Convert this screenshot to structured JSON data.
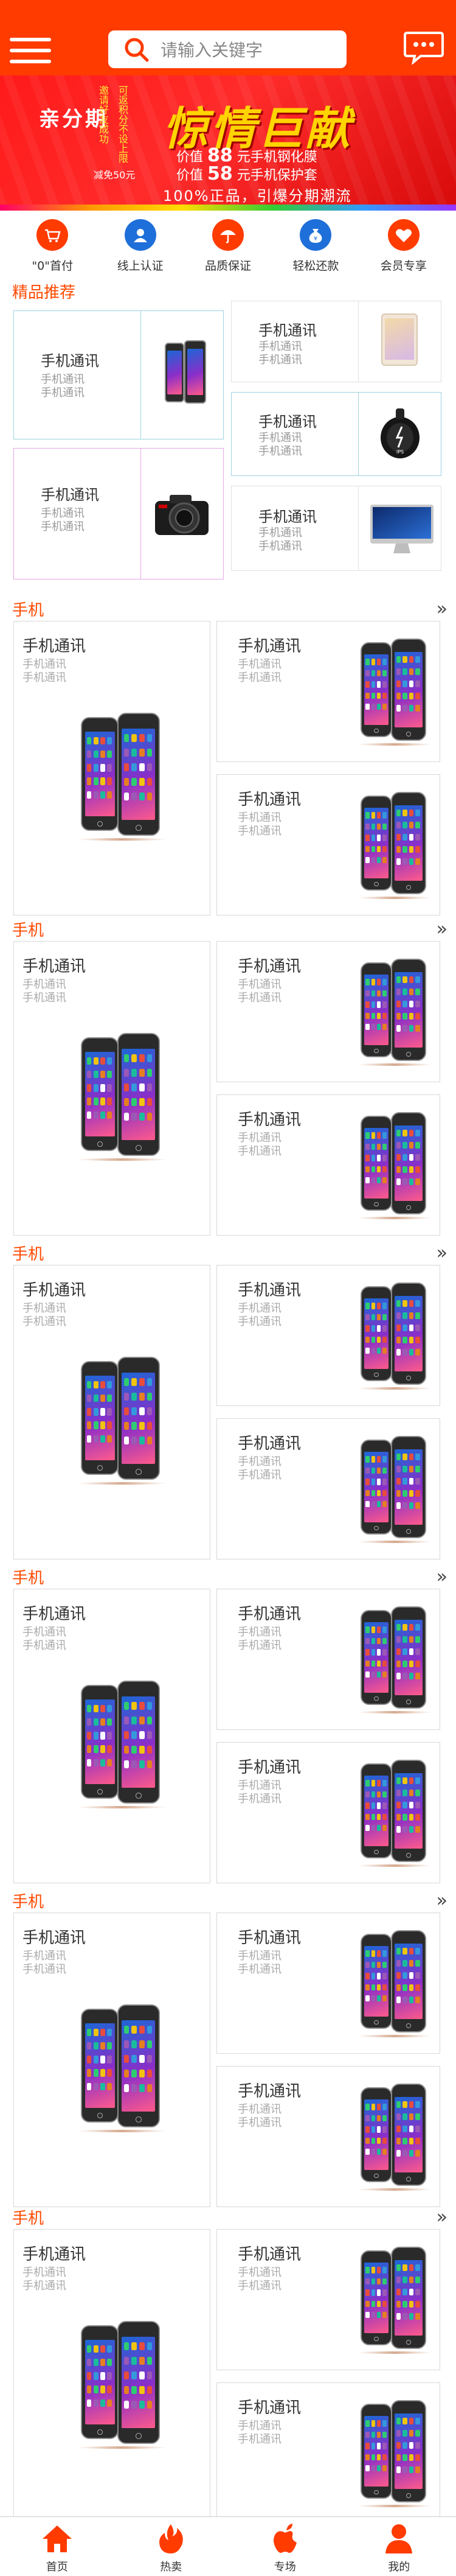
{
  "header": {
    "search_placeholder": "请输入关键字"
  },
  "banner": {
    "left_text": "亲分期",
    "vertical_1": "邀请好友成功",
    "vertical_2": "可返积分不设上限",
    "amount_text": "减免50元",
    "title": "惊情巨献",
    "price_line_1_prefix": "价值",
    "price_line_1_num": "88",
    "price_line_1_suffix": "元手机钢化膜",
    "price_line_2_prefix": "价值",
    "price_line_2_num": "58",
    "price_line_2_suffix": "元手机保护套",
    "slogan": "100%正品，引爆分期潮流"
  },
  "features": [
    {
      "label": "\"0\"首付",
      "icon": "cart-icon"
    },
    {
      "label": "线上认证",
      "icon": "user-icon"
    },
    {
      "label": "品质保证",
      "icon": "umbrella-icon"
    },
    {
      "label": "轻松还款",
      "icon": "moneybag-icon"
    },
    {
      "label": "会员专享",
      "icon": "heart-icon"
    }
  ],
  "featured": {
    "title": "精品推荐",
    "cards": [
      {
        "title": "手机通讯",
        "sub1": "手机通讯",
        "sub2": "手机通讯",
        "image": "iphone"
      },
      {
        "title": "手机通讯",
        "sub1": "手机通讯",
        "sub2": "手机通讯",
        "image": "camera"
      },
      {
        "title": "手机通讯",
        "sub1": "手机通讯",
        "sub2": "手机通讯",
        "image": "ipad"
      },
      {
        "title": "手机通讯",
        "sub1": "手机通讯",
        "sub2": "手机通讯",
        "image": "balance-wheel"
      },
      {
        "title": "手机通讯",
        "sub1": "手机通讯",
        "sub2": "手机通讯",
        "image": "imac"
      }
    ]
  },
  "sections": [
    {
      "title": "手机",
      "more": "»",
      "cards": [
        {
          "title": "手机通讯",
          "sub1": "手机通讯",
          "sub2": "手机通讯"
        },
        {
          "title": "手机通讯",
          "sub1": "手机通讯",
          "sub2": "手机通讯"
        },
        {
          "title": "手机通讯",
          "sub1": "手机通讯",
          "sub2": "手机通讯"
        }
      ]
    },
    {
      "title": "手机",
      "more": "»",
      "cards": [
        {
          "title": "手机通讯",
          "sub1": "手机通讯",
          "sub2": "手机通讯"
        },
        {
          "title": "手机通讯",
          "sub1": "手机通讯",
          "sub2": "手机通讯"
        },
        {
          "title": "手机通讯",
          "sub1": "手机通讯",
          "sub2": "手机通讯"
        }
      ]
    },
    {
      "title": "手机",
      "more": "»",
      "cards": [
        {
          "title": "手机通讯",
          "sub1": "手机通讯",
          "sub2": "手机通讯"
        },
        {
          "title": "手机通讯",
          "sub1": "手机通讯",
          "sub2": "手机通讯"
        },
        {
          "title": "手机通讯",
          "sub1": "手机通讯",
          "sub2": "手机通讯"
        }
      ]
    },
    {
      "title": "手机",
      "more": "»",
      "cards": [
        {
          "title": "手机通讯",
          "sub1": "手机通讯",
          "sub2": "手机通讯"
        },
        {
          "title": "手机通讯",
          "sub1": "手机通讯",
          "sub2": "手机通讯"
        },
        {
          "title": "手机通讯",
          "sub1": "手机通讯",
          "sub2": "手机通讯"
        }
      ]
    },
    {
      "title": "手机",
      "more": "»",
      "cards": [
        {
          "title": "手机通讯",
          "sub1": "手机通讯",
          "sub2": "手机通讯"
        },
        {
          "title": "手机通讯",
          "sub1": "手机通讯",
          "sub2": "手机通讯"
        },
        {
          "title": "手机通讯",
          "sub1": "手机通讯",
          "sub2": "手机通讯"
        }
      ]
    },
    {
      "title": "手机",
      "more": "»",
      "cards": [
        {
          "title": "手机通讯",
          "sub1": "手机通讯",
          "sub2": "手机通讯"
        },
        {
          "title": "手机通讯",
          "sub1": "手机通讯",
          "sub2": "手机通讯"
        },
        {
          "title": "手机通讯",
          "sub1": "手机通讯",
          "sub2": "手机通讯"
        }
      ]
    }
  ],
  "tabbar": [
    {
      "label": "首页",
      "icon": "home-icon"
    },
    {
      "label": "热卖",
      "icon": "flame-icon"
    },
    {
      "label": "专场",
      "icon": "apple-icon"
    },
    {
      "label": "我的",
      "icon": "user-icon"
    }
  ],
  "colors": {
    "accent": "#ff3b00",
    "section_title": "#ff4a00",
    "banner_red": "#ff1a1a",
    "gold": "#ffd400"
  }
}
